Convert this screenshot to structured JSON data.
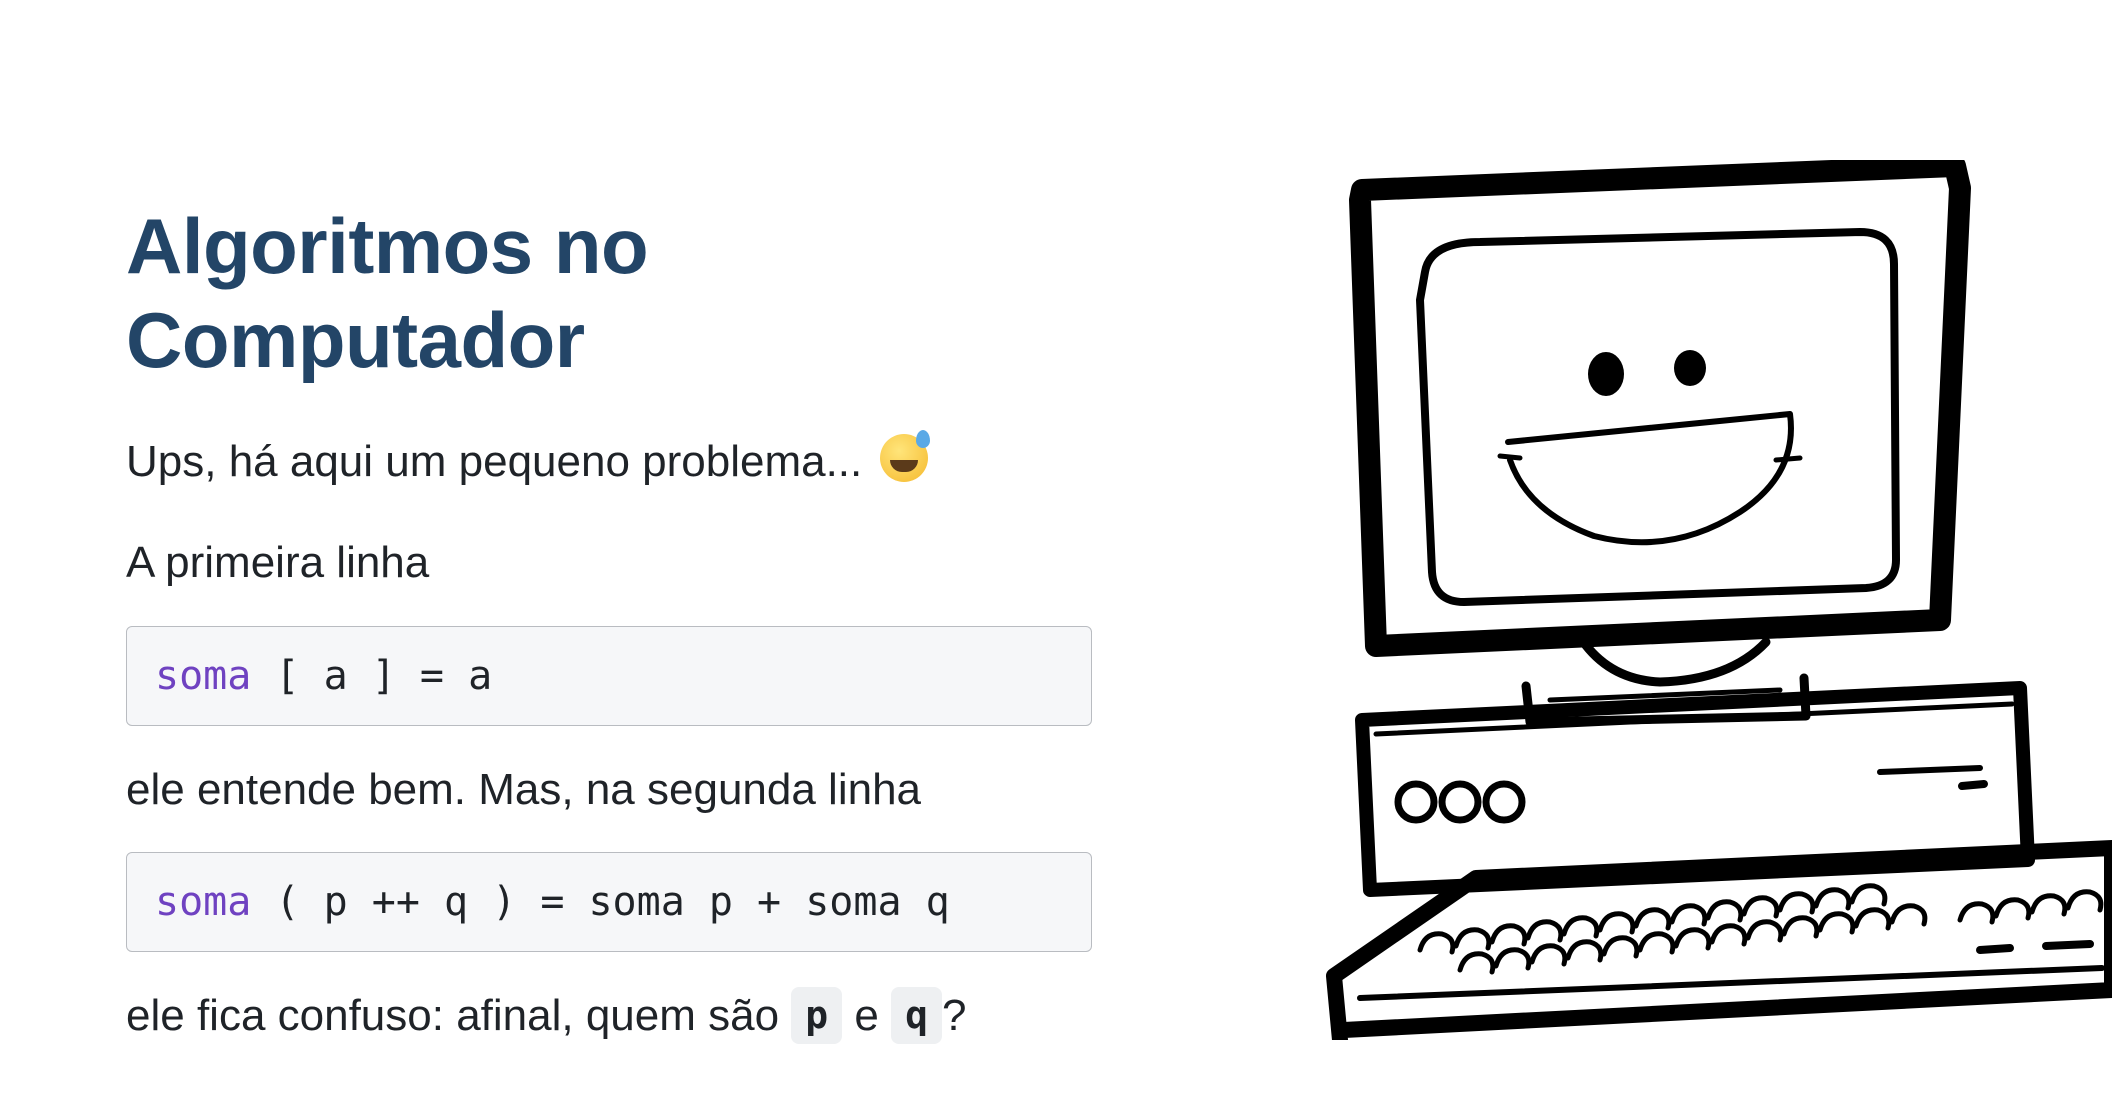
{
  "title": "Algoritmos no Computador",
  "paragraphs": {
    "ups": "Ups, há aqui um pequeno problema...",
    "first_line": "A primeira linha",
    "second_line": "ele entende bem. Mas, na segunda linha",
    "third_prefix": "ele fica confuso: afinal, quem são",
    "third_mid": "e",
    "third_suffix": "?"
  },
  "emoji": "grinning-face-with-sweat-icon",
  "code": {
    "line1": {
      "keyword": "soma",
      "rest": " [ a ] = a"
    },
    "line2": {
      "keyword": "soma",
      "rest": " ( p ++ q ) = soma p + soma q"
    }
  },
  "inline_code": {
    "p": "p",
    "q": "q"
  },
  "colors": {
    "title": "#234567",
    "keyword": "#6f42c1",
    "code_bg": "#f6f7f9"
  }
}
